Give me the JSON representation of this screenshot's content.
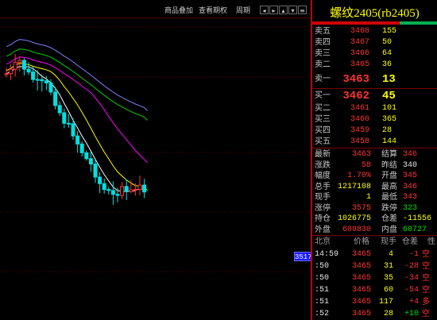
{
  "toolbar": {
    "buttons": [
      "商品叠加",
      "查看期权",
      "周期"
    ],
    "controls": [
      "◂",
      "▸",
      "▴",
      "▾",
      "≡"
    ]
  },
  "chart": {
    "current_price_tag": "3517",
    "colors": {
      "up": "#ff3333",
      "down": "#00e0e0",
      "ma5": "#ffffff",
      "ma10": "#ffff00",
      "ma20": "#ff00ff",
      "ma40": "#00d000",
      "ma60": "#8080ff"
    }
  },
  "panel": {
    "title": "螺纹2405(rb2405)",
    "asks": [
      {
        "label": "卖五",
        "price": "3468",
        "vol": "155"
      },
      {
        "label": "卖四",
        "price": "3467",
        "vol": "50"
      },
      {
        "label": "卖三",
        "price": "3466",
        "vol": "64"
      },
      {
        "label": "卖二",
        "price": "3465",
        "vol": "36"
      },
      {
        "label": "卖一",
        "price": "3463",
        "vol": "13"
      }
    ],
    "bids": [
      {
        "label": "买一",
        "price": "3462",
        "vol": "45"
      },
      {
        "label": "买二",
        "price": "3461",
        "vol": "101"
      },
      {
        "label": "买三",
        "price": "3460",
        "vol": "365"
      },
      {
        "label": "买四",
        "price": "3459",
        "vol": "28"
      },
      {
        "label": "买五",
        "price": "3458",
        "vol": "144"
      }
    ],
    "stats": [
      {
        "l1": "最新",
        "v1": "3463",
        "c1": "red",
        "l2": "结算",
        "v2": "346",
        "c2": "red"
      },
      {
        "l1": "涨跌",
        "v1": "58",
        "c1": "red",
        "l2": "昨结",
        "v2": "340",
        "c2": "white"
      },
      {
        "l1": "幅度",
        "v1": "1.70%",
        "c1": "red",
        "l2": "开盘",
        "v2": "345",
        "c2": "red"
      },
      {
        "l1": "总手",
        "v1": "1217108",
        "c1": "yellow",
        "l2": "最高",
        "v2": "346",
        "c2": "red"
      },
      {
        "l1": "现手",
        "v1": "1",
        "c1": "yellow",
        "l2": "最低",
        "v2": "343",
        "c2": "red"
      },
      {
        "l1": "涨停",
        "v1": "3575",
        "c1": "red",
        "l2": "跌停",
        "v2": "323",
        "c2": "green"
      },
      {
        "l1": "持仓",
        "v1": "1026775",
        "c1": "yellow",
        "l2": "仓差",
        "v2": "-11556",
        "c2": "yellow"
      },
      {
        "l1": "外盘",
        "v1": "609830",
        "c1": "red",
        "l2": "内盘",
        "v2": "60727",
        "c2": "green"
      }
    ],
    "ticks_header": {
      "col1": "北京",
      "col2": "价格",
      "col3": "现手",
      "col4": "仓差",
      "col5": "性"
    },
    "ticks": [
      {
        "time": "14:59",
        "price": "3465",
        "vol": "4",
        "oi": "-1",
        "nat": "空",
        "oi_color": "red"
      },
      {
        "time": ":50",
        "price": "3465",
        "vol": "31",
        "oi": "-28",
        "nat": "空",
        "oi_color": "red"
      },
      {
        "time": ":50",
        "price": "3465",
        "vol": "35",
        "oi": "-34",
        "nat": "空",
        "oi_color": "red"
      },
      {
        "time": ":51",
        "price": "3465",
        "vol": "60",
        "oi": "-54",
        "nat": "空",
        "oi_color": "red"
      },
      {
        "time": ":51",
        "price": "3465",
        "vol": "117",
        "oi": "+4",
        "nat": "多",
        "oi_color": "red"
      },
      {
        "time": ":52",
        "price": "3465",
        "vol": "28",
        "oi": "+10",
        "nat": "空",
        "oi_color": "green"
      }
    ]
  }
}
